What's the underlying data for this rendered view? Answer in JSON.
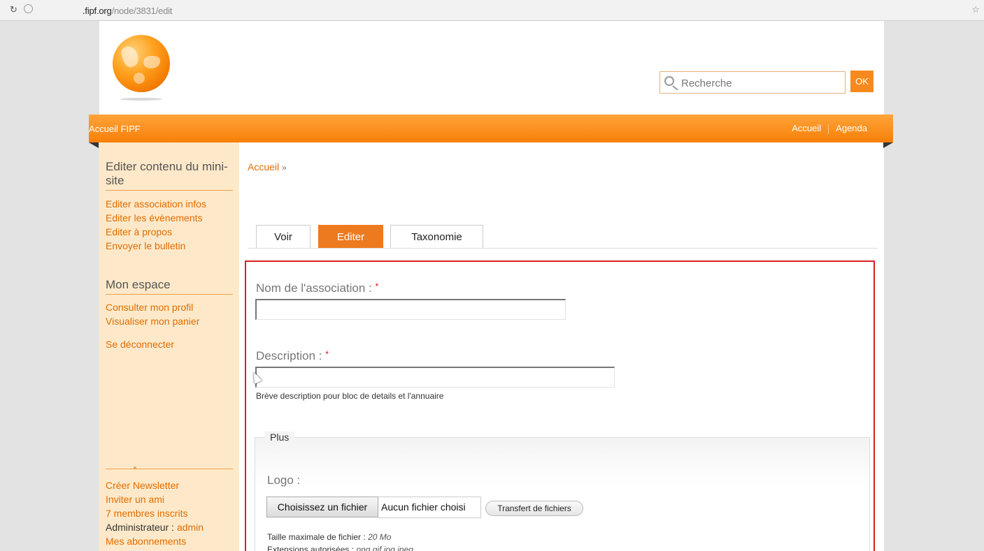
{
  "browser": {
    "url_domain": ".fipf.org",
    "url_path": "/node/3831/edit"
  },
  "header": {
    "search_placeholder": "Recherche",
    "search_button": "OK"
  },
  "nav": {
    "home_label": "Accueil FIPF",
    "right_items": [
      "Accueil",
      "Agenda"
    ]
  },
  "sidebar": {
    "section1_title": "Editer contenu du mini-site",
    "section1_links": [
      "Editer association infos",
      "Editer les évènements",
      "Editer à propos",
      "Envoyer le bulletin"
    ],
    "section2_title": "Mon espace",
    "section2_links": [
      "Consulter mon profil",
      "Visualiser mon panier"
    ],
    "logout": "Se déconnecter",
    "bottom_links": [
      "Créer Newsletter",
      "Inviter un ami",
      "7 membres inscrits"
    ],
    "admin_label": "Administrateur : ",
    "admin_user": "admin",
    "subscriptions": "Mes abonnements"
  },
  "main": {
    "breadcrumb": "Accueil",
    "breadcrumb_sep": "»",
    "tabs": [
      {
        "label": "Voir",
        "active": false
      },
      {
        "label": "Editer",
        "active": true
      },
      {
        "label": "Taxonomie",
        "active": false
      }
    ],
    "form": {
      "name_label": "Nom de l'association : ",
      "name_value": "",
      "description_label": "Description : ",
      "description_value": "",
      "description_help": "Brève description pour bloc de details et l'annuaire",
      "required_mark": "*",
      "fieldset_legend": "Plus",
      "logo_label": "Logo :",
      "file_button": "Choisissez un fichier",
      "file_status": "Aucun fichier choisi",
      "upload_button": "Transfert de fichiers",
      "max_size_label": "Taille maximale de fichier : ",
      "max_size_value": "20 Mo",
      "extensions_label": "Extensions autorisées : ",
      "extensions_value": "png gif jpg jpeg"
    }
  },
  "colors": {
    "accent": "#f68a1e",
    "sidebar_bg": "#fde9c9",
    "link": "#e36c00",
    "form_border": "#d92020"
  }
}
